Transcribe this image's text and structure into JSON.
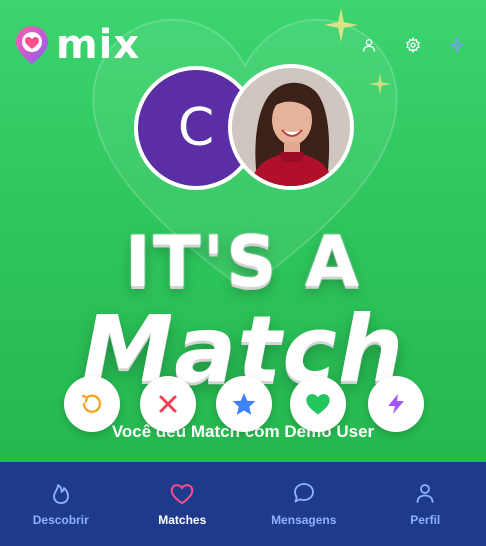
{
  "brand": {
    "name": "mix"
  },
  "header": {
    "icons": [
      "user-icon",
      "gear-icon",
      "sparkle-icon"
    ]
  },
  "match_screen": {
    "avatar_initial": "C",
    "headline": "IT'S A",
    "headline_big": "Match",
    "subtitle": "Você deu Match com Demo User"
  },
  "actions": [
    {
      "name": "rewind",
      "icon": "rewind-icon",
      "color": "#f5a623"
    },
    {
      "name": "nope",
      "icon": "close-icon",
      "color": "#f0435a"
    },
    {
      "name": "super-like",
      "icon": "star-icon",
      "color": "#3b82f6"
    },
    {
      "name": "like",
      "icon": "heart-icon",
      "color": "#22c55e"
    },
    {
      "name": "boost",
      "icon": "bolt-icon",
      "color": "#a855f7"
    }
  ],
  "nav": {
    "items": [
      {
        "label": "Descobrir",
        "icon": "flame-icon",
        "active": false
      },
      {
        "label": "Matches",
        "icon": "heart-icon",
        "active": true
      },
      {
        "label": "Mensagens",
        "icon": "chat-icon",
        "active": false
      },
      {
        "label": "Perfil",
        "icon": "user-icon",
        "active": false
      }
    ]
  },
  "colors": {
    "background": "#2fc65e",
    "nav_bg": "#1e3a8a",
    "avatar_bg": "#5b2ea6",
    "active_icon": "#ff4d8d"
  }
}
